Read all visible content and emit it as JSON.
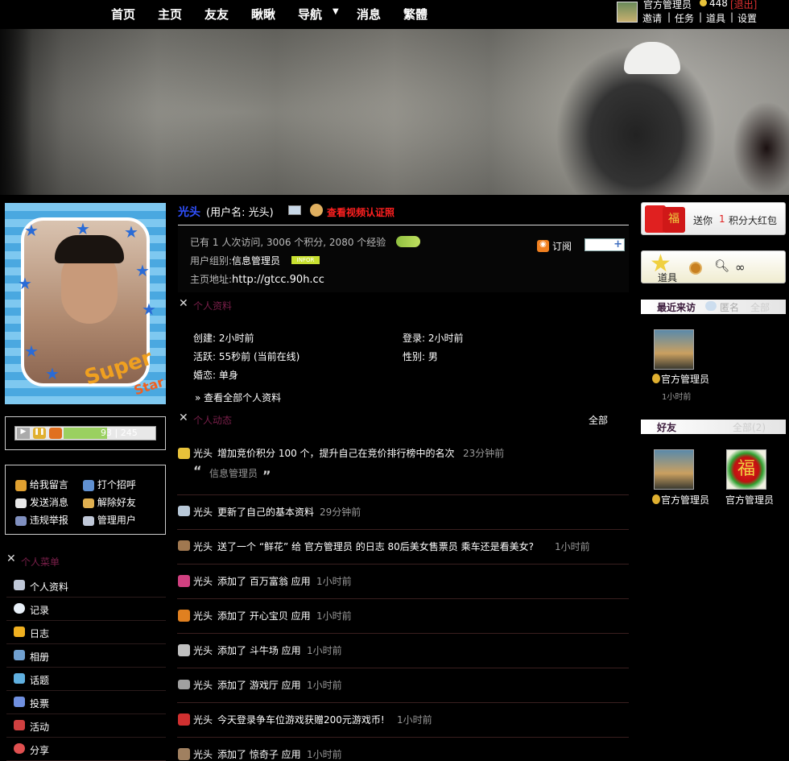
{
  "nav": {
    "items": [
      "首页",
      "主页",
      "友友",
      "瞅瞅",
      "导航",
      "消息",
      "繁體"
    ],
    "user_name": "官方管理员",
    "coins": "448",
    "logout": "[退出]",
    "links": [
      "邀请",
      "任务",
      "道具",
      "设置"
    ],
    "sep": "|"
  },
  "profile": {
    "name": "光头",
    "username": "(用户名: 光头)",
    "video_link": "查看视频认证照",
    "stats_prefix": "已有",
    "stats_visits": "1",
    "stats_text": "人次访问, 3006 个积分, 2080 个经验",
    "group_label": "用户组别:",
    "group_value": "信息管理员",
    "group_badge": "INFOR",
    "home_label": "主页地址:",
    "home_url": "http://gtcc.90h.cc",
    "subscribe": "订阅"
  },
  "personal_info": {
    "title": "个人资料",
    "created": "创建: 2小时前",
    "login": "登录: 2小时前",
    "active": "活跃: 55秒前 (当前在线)",
    "gender": "性别: 男",
    "marriage": "婚恋: 单身",
    "view_all": "» 查看全部个人资料"
  },
  "activity": {
    "title": "个人动态",
    "all": "全部",
    "items": [
      {
        "user": "光头",
        "text": "增加竞价积分  100 个，提升自己在竞价排行榜中的名次",
        "time": "23分钟前",
        "icon": "coin-icon",
        "color": "#e8c23a"
      },
      {
        "user": "光头",
        "text": "更新了自己的基本资料",
        "time": "29分钟前",
        "icon": "profile-card-icon",
        "color": "#b8c8d8"
      },
      {
        "user": "光头",
        "text": "送了一个 “鲜花” 给  官方管理员  的日志  80后美女售票员  乘车还是看美女?",
        "time": "1小时前",
        "icon": "flower-gift-icon",
        "color": "#a07850"
      },
      {
        "user": "光头",
        "text": "添加了  百万富翁  应用",
        "time": "1小时前",
        "icon": "millionaire-app-icon",
        "color": "#d04080"
      },
      {
        "user": "光头",
        "text": "添加了  开心宝贝  应用",
        "time": "1小时前",
        "icon": "happy-baby-app-icon",
        "color": "#e08020"
      },
      {
        "user": "光头",
        "text": "添加了  斗牛场  应用",
        "time": "1小时前",
        "icon": "bullfight-app-icon",
        "color": "#c0c0c0"
      },
      {
        "user": "光头",
        "text": "添加了  游戏厅  应用",
        "time": "1小时前",
        "icon": "game-hall-app-icon",
        "color": "#a0a0a0"
      },
      {
        "user": "光头",
        "text": "今天登录争车位游戏获赠200元游戏币!",
        "time": "1小时前",
        "icon": "parking-game-icon",
        "color": "#d03030"
      },
      {
        "user": "光头",
        "text": "添加了  惊奇子  应用",
        "time": "1小时前",
        "icon": "app-icon",
        "color": "#a08060"
      }
    ],
    "quote": "信息管理员"
  },
  "player": {
    "value": "93 | 245",
    "progress": 0.38
  },
  "actions": [
    {
      "label": "给我留言",
      "icon": "pen-icon"
    },
    {
      "label": "打个招呼",
      "icon": "wave-icon"
    },
    {
      "label": "发送消息",
      "icon": "envelope-icon"
    },
    {
      "label": "解除好友",
      "icon": "handshake-icon"
    },
    {
      "label": "违规举报",
      "icon": "eye-icon"
    },
    {
      "label": "管理用户",
      "icon": "user-card-icon"
    }
  ],
  "menu": {
    "title": "个人菜单",
    "items": [
      {
        "label": "个人资料",
        "icon": "profile-icon"
      },
      {
        "label": "记录",
        "icon": "chat-bubble-icon"
      },
      {
        "label": "日志",
        "icon": "diary-icon"
      },
      {
        "label": "相册",
        "icon": "photo-icon"
      },
      {
        "label": "话题",
        "icon": "topic-icon"
      },
      {
        "label": "投票",
        "icon": "poll-icon"
      },
      {
        "label": "活动",
        "icon": "calendar-icon"
      },
      {
        "label": "分享",
        "icon": "share-icon"
      }
    ]
  },
  "right": {
    "redpacket_text": "送你",
    "redpacket_num": "1",
    "redpacket_suffix": "积分大红包",
    "tools_label": "道具",
    "recent_title": "最近来访",
    "anon": "匿名",
    "all": "全部",
    "recent_user": "官方管理员",
    "recent_time": "1小时前",
    "friends_title": "好友",
    "friends_all": "全部(2)",
    "friends": [
      "官方管理员",
      "官方管理员"
    ]
  }
}
